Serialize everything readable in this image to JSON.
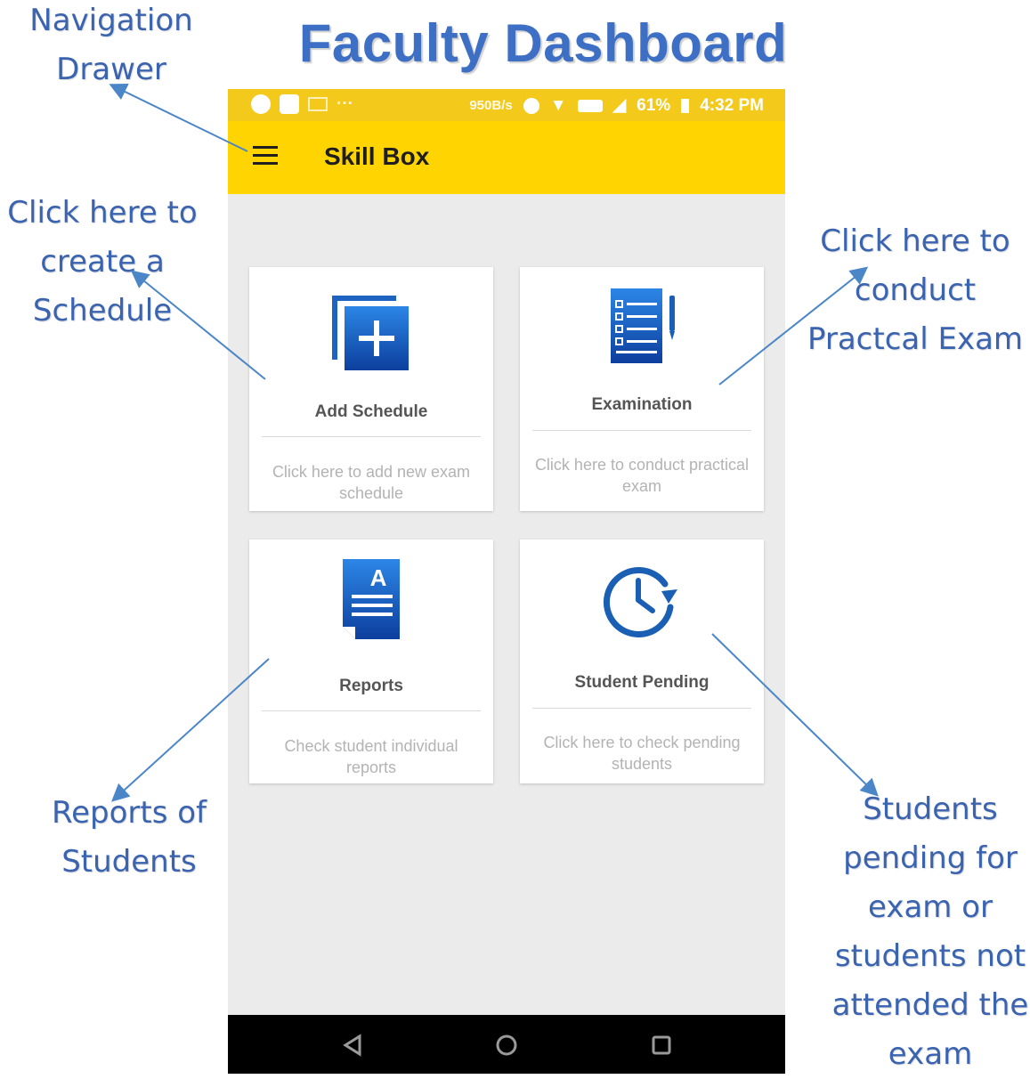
{
  "page_title": "Faculty Dashboard",
  "annotations": {
    "nav_drawer": [
      "Navigation",
      "Drawer"
    ],
    "schedule": [
      "Click here to",
      "create a",
      "Schedule"
    ],
    "exam": [
      "Click here to",
      "conduct",
      "Practcal Exam"
    ],
    "reports": [
      "Reports of",
      "Students"
    ],
    "pending": [
      "Students",
      "pending for",
      "exam or",
      "students not",
      "attended the",
      "exam"
    ]
  },
  "status_bar": {
    "network_speed": "950B/s",
    "battery": "61%",
    "time": "4:32 PM"
  },
  "app": {
    "title": "Skill Box"
  },
  "cards": [
    {
      "title": "Add Schedule",
      "description": "Click here to add new exam schedule",
      "icon": "add-schedule-icon"
    },
    {
      "title": "Examination",
      "description": "Click here to conduct practical exam",
      "icon": "exam-checklist-icon"
    },
    {
      "title": "Reports",
      "description": "Check student individual reports",
      "icon": "report-document-icon"
    },
    {
      "title": "Student Pending",
      "description": "Click here to check pending students",
      "icon": "clock-pending-icon"
    }
  ],
  "colors": {
    "app_bar": "#ffd400",
    "status_bar": "#f3ca1c",
    "annotation_text": "#3a63b0",
    "icon_blue": "#1a5fb4"
  }
}
